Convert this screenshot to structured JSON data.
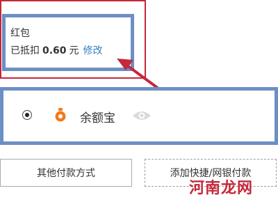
{
  "coupon": {
    "title": "红包",
    "deducted_prefix": "已抵扣",
    "amount": "0.60",
    "unit": "元",
    "modify_label": "修改"
  },
  "payment": {
    "method_label": "余额宝",
    "selected": true,
    "method_icon": "yuebao-icon",
    "visibility_icon": "eye-icon"
  },
  "buttons": {
    "other_payment": "其他付款方式",
    "add_card": "添加快捷/网银付款"
  },
  "watermark": {
    "text": "河南龙网"
  },
  "colors": {
    "annotation_red": "#c4283a",
    "annotation_blue": "#6c8fc5",
    "link_blue": "#2f7fc1",
    "yuebao_orange": "#f07c1e"
  }
}
